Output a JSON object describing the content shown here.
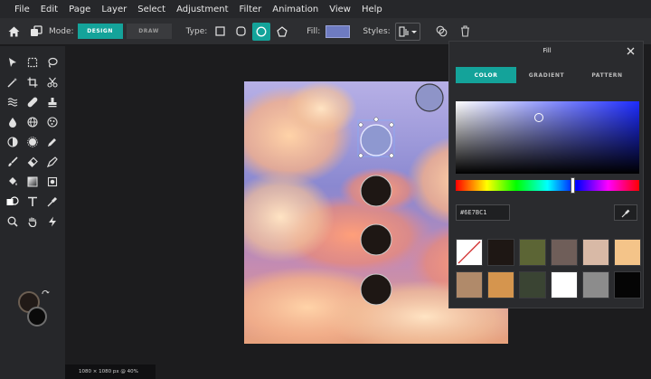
{
  "menu": {
    "items": [
      "File",
      "Edit",
      "Page",
      "Layer",
      "Select",
      "Adjustment",
      "Filter",
      "Animation",
      "View",
      "Help"
    ]
  },
  "options": {
    "mode_label": "Mode:",
    "design_label": "DESIGN",
    "draw_label": "DRAW",
    "type_label": "Type:",
    "fill_label": "Fill:",
    "fill_color": "#6E7BC1",
    "styles_label": "Styles:"
  },
  "toolbar": {
    "foreground_color": "#211a17",
    "background_color": "#0a0a0a"
  },
  "canvas": {
    "status": "1080 × 1080 px @ 40%"
  },
  "fill_panel": {
    "title": "Fill",
    "tabs": [
      "COLOR",
      "GRADIENT",
      "PATTERN"
    ],
    "active_tab": "COLOR",
    "hex_value": "#6E7BC1",
    "swatches": [
      {
        "color": "none"
      },
      {
        "color": "#1e1714"
      },
      {
        "color": "#5c6535"
      },
      {
        "color": "#6f5e59"
      },
      {
        "color": "#d8b9a6"
      },
      {
        "color": "#f4c489"
      },
      {
        "color": "#b08a6a"
      },
      {
        "color": "#d5954e"
      },
      {
        "color": "#3a4433"
      },
      {
        "color": "#ffffff"
      },
      {
        "color": "#8c8c8c"
      },
      {
        "color": "#050505"
      }
    ]
  }
}
